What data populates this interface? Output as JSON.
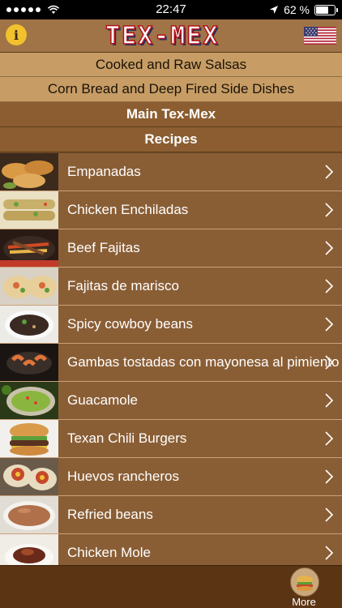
{
  "status_bar": {
    "time": "22:47",
    "battery": "62 %",
    "battery_level": 0.62,
    "icons": [
      "signal-dots-icon",
      "wifi-icon",
      "location-arrow-icon",
      "battery-icon"
    ]
  },
  "nav": {
    "title": "TEX-MEX",
    "info_icon": "info-icon",
    "info_glyph": "i",
    "flag_icon": "us-flag-icon"
  },
  "categories": [
    {
      "label": "Cooked and Raw Salsas"
    },
    {
      "label": "Corn Bread and Deep Fired Side Dishes"
    }
  ],
  "headers": {
    "main": "Main Tex-Mex",
    "recipes": "Recipes"
  },
  "recipes": [
    {
      "label": "Empanadas",
      "thumb": "empanadas"
    },
    {
      "label": "Chicken Enchiladas",
      "thumb": "enchiladas"
    },
    {
      "label": "Beef Fajitas",
      "thumb": "fajitas"
    },
    {
      "label": "Fajitas de marisco",
      "thumb": "marisco"
    },
    {
      "label": "Spicy cowboy beans",
      "thumb": "beans"
    },
    {
      "label": "Gambas tostadas con mayonesa al pimiento",
      "thumb": "gambas"
    },
    {
      "label": "Guacamole",
      "thumb": "guacamole"
    },
    {
      "label": "Texan Chili Burgers",
      "thumb": "burger"
    },
    {
      "label": "Huevos rancheros",
      "thumb": "huevos"
    },
    {
      "label": "Refried beans",
      "thumb": "refried"
    },
    {
      "label": "Chicken Mole",
      "thumb": "mole"
    }
  ],
  "tabbar": {
    "more_label": "More",
    "more_icon": "more-tab-icon"
  }
}
